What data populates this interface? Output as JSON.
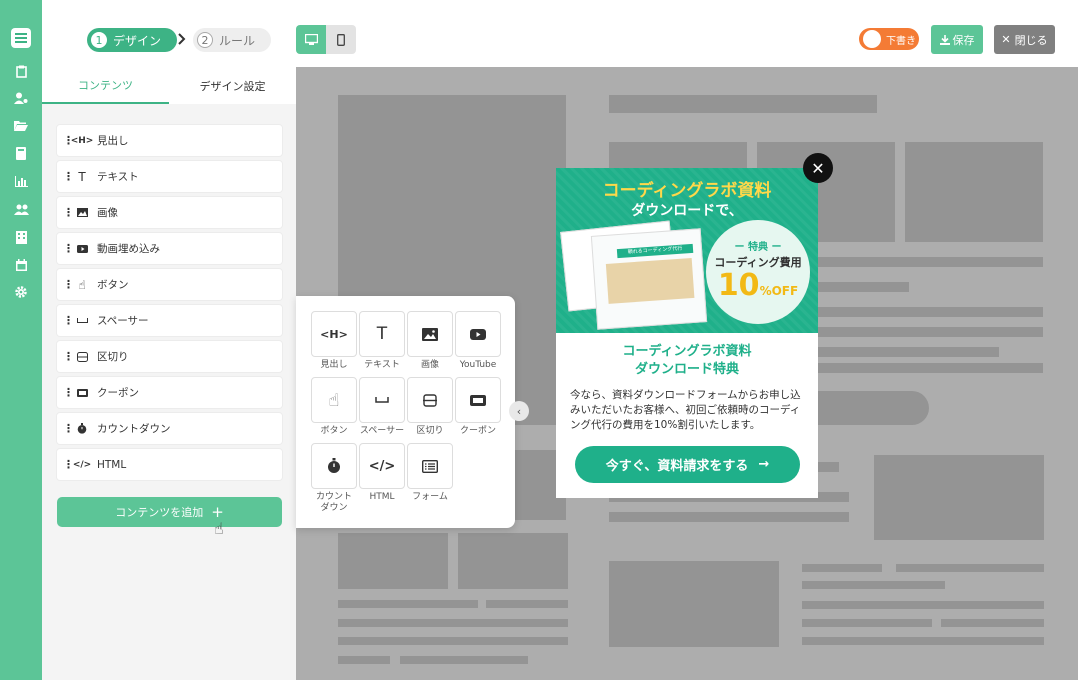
{
  "steps": [
    {
      "num": "1",
      "label": "デザイン"
    },
    {
      "num": "2",
      "label": "ルール"
    }
  ],
  "toolbar": {
    "draft_label": "下書き",
    "save_label": "保存",
    "close_label": "閉じる"
  },
  "panel": {
    "tabs": [
      "コンテンツ",
      "デザイン設定"
    ],
    "items": [
      {
        "label": "見出し",
        "icon": "heading-icon"
      },
      {
        "label": "テキスト",
        "icon": "text-icon"
      },
      {
        "label": "画像",
        "icon": "image-icon"
      },
      {
        "label": "動画埋め込み",
        "icon": "video-icon"
      },
      {
        "label": "ボタン",
        "icon": "pointer-icon"
      },
      {
        "label": "スペーサー",
        "icon": "spacer-icon"
      },
      {
        "label": "区切り",
        "icon": "divider-icon"
      },
      {
        "label": "クーポン",
        "icon": "coupon-icon"
      },
      {
        "label": "カウントダウン",
        "icon": "timer-icon"
      },
      {
        "label": "HTML",
        "icon": "code-icon"
      }
    ],
    "add_label": "コンテンツを追加"
  },
  "palette": {
    "items": [
      {
        "label": "見出し",
        "glyph": "<H>"
      },
      {
        "label": "テキスト",
        "glyph": "T"
      },
      {
        "label": "画像",
        "glyph": "img"
      },
      {
        "label": "YouTube",
        "glyph": "yt"
      },
      {
        "label": "ボタン",
        "glyph": "hand"
      },
      {
        "label": "スペーサー",
        "glyph": "space"
      },
      {
        "label": "区切り",
        "glyph": "div"
      },
      {
        "label": "クーポン",
        "glyph": "coupon"
      },
      {
        "label": "カウント\nダウン",
        "glyph": "timer"
      },
      {
        "label": "HTML",
        "glyph": "</>"
      },
      {
        "label": "フォーム",
        "glyph": "form"
      }
    ]
  },
  "popup": {
    "headline1": "コーディングラボ資料",
    "headline2": "ダウンロードで、",
    "badge_label": "ー 特典 ー",
    "badge_subject": "コーディング費用",
    "badge_value": "10",
    "badge_unit": "%OFF",
    "doc_band": "頼れるコーディング代行",
    "title_line1": "コーディングラボ資料",
    "title_line2": "ダウンロード特典",
    "body": "今なら、資料ダウンロードフォームからお申し込みいただいたお客様へ、初回ご依頼時のコーディング代行の費用を10%割引いたします。",
    "cta": "今すぐ、資料請求をする"
  },
  "colors": {
    "brand": "#5cc597",
    "accent": "#1fb08a",
    "draft": "#f47b35",
    "yellow": "#ffd84a"
  }
}
